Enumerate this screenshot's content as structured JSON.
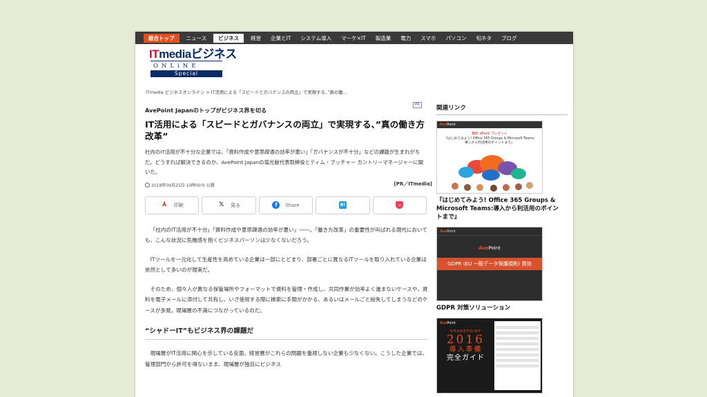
{
  "nav": {
    "items": [
      "総合トップ",
      "ニュース",
      "ビジネス",
      "経営",
      "企業とIT",
      "システム導入",
      "マーケ×IT",
      "製造業",
      "電力",
      "スマホ",
      "パソコン",
      "旬ネタ",
      "ブログ"
    ],
    "active": "ビジネス"
  },
  "logo": {
    "it": "IT",
    "media": "mediaビジネス",
    "sub": "ONLiNE",
    "special": "Special"
  },
  "breadcrumb": "ITmedia ビジネスオンライン > IT活用による「スピードとガバナンスの両立」で実現する、”真の働...",
  "article": {
    "pr_badge": "PR",
    "kicker": "AvePoint Japanのトップがビジネス界を切る",
    "headline": "IT活用による「スピードとガバナンスの両立」で実現する、”真の働き方改革”",
    "lead": "社内のIT活用が不十分な企業では、「資料作成や意思疎通の効率が悪い」「ガバナンスが不十分」などの課題が生まれがちだ。どうすれば解決できるのか、AvePoint Japanの塩光献代表取締役とティム・ブッチャー カントリーマネージャーに聞いた。",
    "date": "2018年09月25日 10時00分 公開",
    "source": "[PR／ITmedia]",
    "share": {
      "print": "印刷",
      "x": "見る",
      "facebook": "Share",
      "hatena": "",
      "pocket": ""
    },
    "paragraphs": [
      "「社内のIT活用が不十分」「資料作成や意思疎通の効率が悪い」――。「働き方改革」の重要性が叫ばれる現代においても、こんな状況に危機感を抱くビジネスパーソンは少なくないだろう。",
      "ITツールを一元化して生産性を高めている企業は一部にとどまり、部署ごとに異なるITツールを取り入れている企業は依然として多いのが現実だ。",
      "そのため、個々人が異なる保管場所やフォーマットで資料を管理・作成し、共同作業が効率よく進まないケースや、資料を電子メールに添付して共有し、いざ使用する際に検索に手間がかかる、あるいはメールごと紛失してしまうなどのケースが多発。現場層の不満につながっているのだ。"
    ],
    "section_heading": "“シャドーIT”もビジネス界の課題だ",
    "paragraph_after": "現場層がIT活用に関心を示している反面、経営層がこれらの問題を重視しない企業も少なくない。こうした企業では、管理部門から許可を得ないまま、現場層が独自にビジネス"
  },
  "sidebar": {
    "title": "関連リンク",
    "ad1": {
      "brand_a": "Ave",
      "brand_b": "Point",
      "line1": "無料 eBook プレゼント",
      "line2": "「はじめてみよう! Office 365 Groups & Microsoft Teams:",
      "line3": "導入から利活用のポイントまで」"
    },
    "caption1": "『はじめてみよう! Office 365 Groups & Microsoft Teams:導入から利活用のポイントまで』",
    "ad2": {
      "brand_a": "Ave",
      "brand_b": "Point",
      "inner_a": "Ave",
      "inner_b": "Point",
      "gdpr": "GDPR (EU 一般データ保護規則) 発効",
      "footer": ""
    },
    "caption2": "GDPR 対策ソリューション",
    "ad3": {
      "brand_a": "Ave",
      "brand_b": "Point",
      "sharepoint": "SHAREPOINT",
      "year": "2016",
      "title1": "導入準備",
      "title2": "完全ガイド"
    }
  }
}
